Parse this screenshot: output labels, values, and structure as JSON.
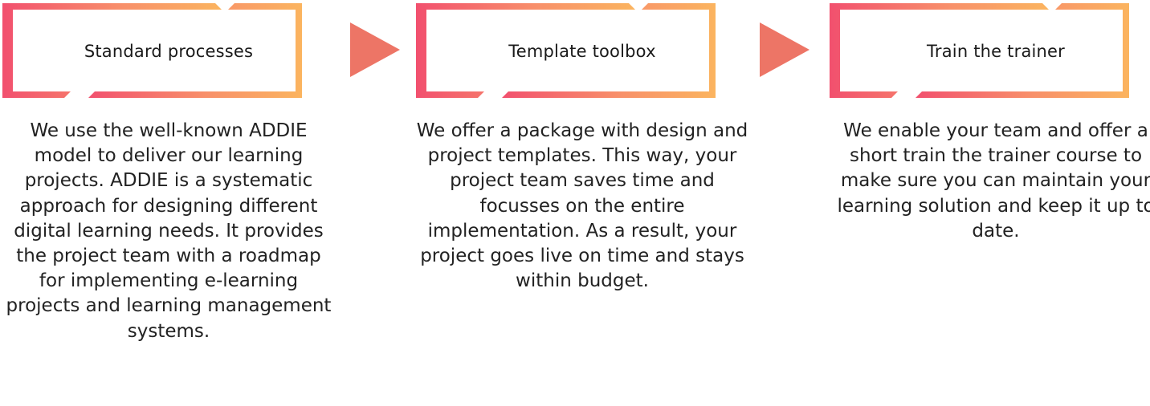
{
  "colors": {
    "gradient_start": "#f2506e",
    "gradient_mid": "#f8906a",
    "gradient_end": "#fbb45f",
    "arrow": "#ed7566",
    "text": "#222222"
  },
  "steps": [
    {
      "title": "Standard processes",
      "description": "We use the well-known ADDIE model to deliver our learning projects. ADDIE is a systematic approach for designing different digital learning needs. It provides the project team with a roadmap for implementing e-learning projects and learning management systems."
    },
    {
      "title": "Template toolbox",
      "description": "We offer a package with design and project templates. This way, your project team saves time and focusses on the entire implementation. As a result, your project goes live on time and stays within budget."
    },
    {
      "title": "Train the trainer",
      "description": "We enable your team and offer a short train the trainer course to make sure you can maintain your learning solution and keep it up to date."
    }
  ],
  "arrows": [
    "play-arrow-icon",
    "play-arrow-icon"
  ]
}
